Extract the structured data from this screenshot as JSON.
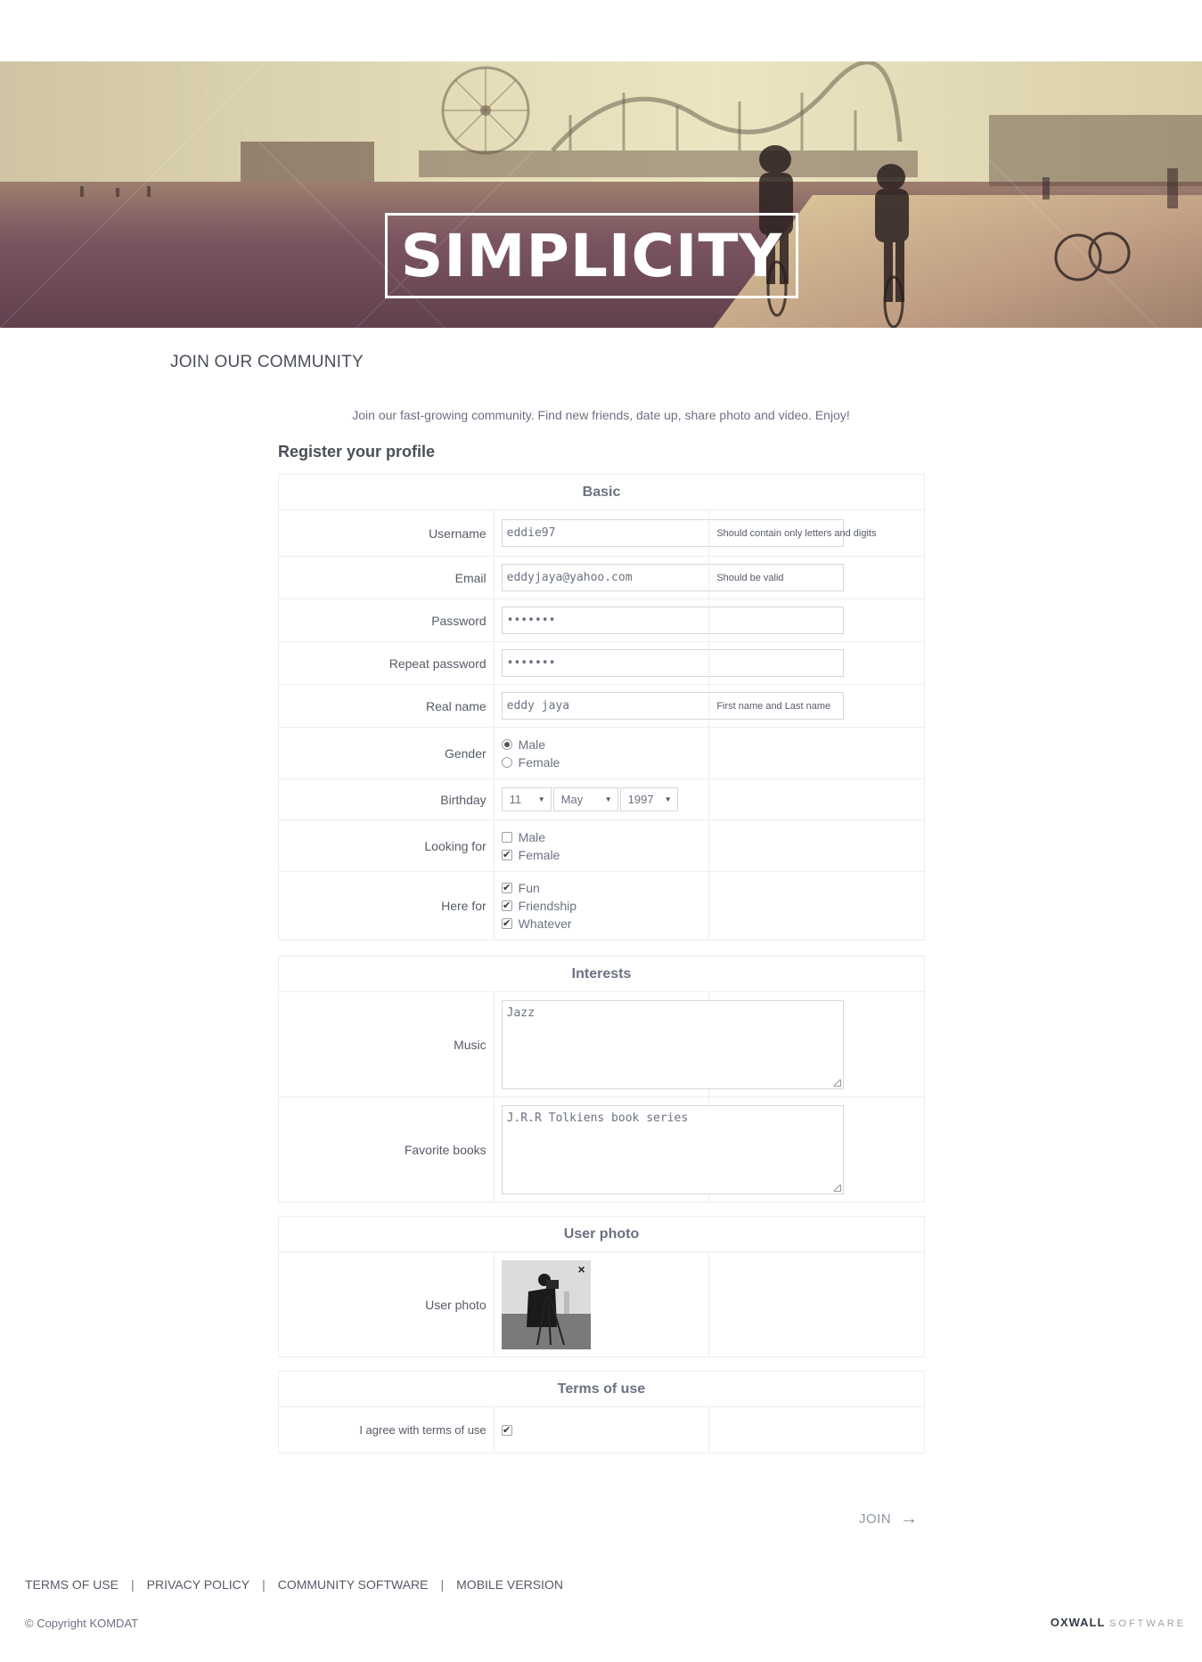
{
  "banner": {
    "logo_text": "SIMPLICITY"
  },
  "page": {
    "title": "JOIN OUR COMMUNITY",
    "intro": "Join our fast-growing community. Find new friends, date up, share photo and video. Enjoy!",
    "register_title": "Register your profile"
  },
  "basic": {
    "section_title": "Basic",
    "username": {
      "label": "Username",
      "value": "eddie97",
      "hint": "Should contain only letters and digits"
    },
    "email": {
      "label": "Email",
      "value": "eddyjaya@yahoo.com",
      "hint": "Should be valid"
    },
    "password": {
      "label": "Password",
      "value": "•••••••"
    },
    "repeat_password": {
      "label": "Repeat password",
      "value": "•••••••"
    },
    "real_name": {
      "label": "Real name",
      "value": "eddy jaya",
      "hint": "First name and Last name"
    },
    "gender": {
      "label": "Gender",
      "options": [
        "Male",
        "Female"
      ],
      "selected": "Male"
    },
    "birthday": {
      "label": "Birthday",
      "day": "11",
      "month": "May",
      "year": "1997"
    },
    "looking_for": {
      "label": "Looking for",
      "options": [
        "Male",
        "Female"
      ],
      "checked": [
        "Female"
      ]
    },
    "here_for": {
      "label": "Here for",
      "options": [
        "Fun",
        "Friendship",
        "Whatever"
      ],
      "checked": [
        "Fun",
        "Friendship",
        "Whatever"
      ]
    }
  },
  "interests": {
    "section_title": "Interests",
    "music": {
      "label": "Music",
      "value": "Jazz"
    },
    "books": {
      "label": "Favorite books",
      "value": "J.R.R Tolkiens book series"
    }
  },
  "photo": {
    "section_title": "User photo",
    "label": "User photo",
    "remove_glyph": "×"
  },
  "terms": {
    "section_title": "Terms of use",
    "label": "I agree with terms of use",
    "checked": true
  },
  "join_button": {
    "label": "JOIN",
    "arrow": "→"
  },
  "footer": {
    "links": [
      "TERMS OF USE",
      "PRIVACY POLICY",
      "COMMUNITY SOFTWARE",
      "MOBILE VERSION"
    ],
    "separator": "|",
    "copyright": "© Copyright KOMDAT",
    "brand_bold": "OXWALL",
    "brand_light": "SOFTWARE"
  }
}
